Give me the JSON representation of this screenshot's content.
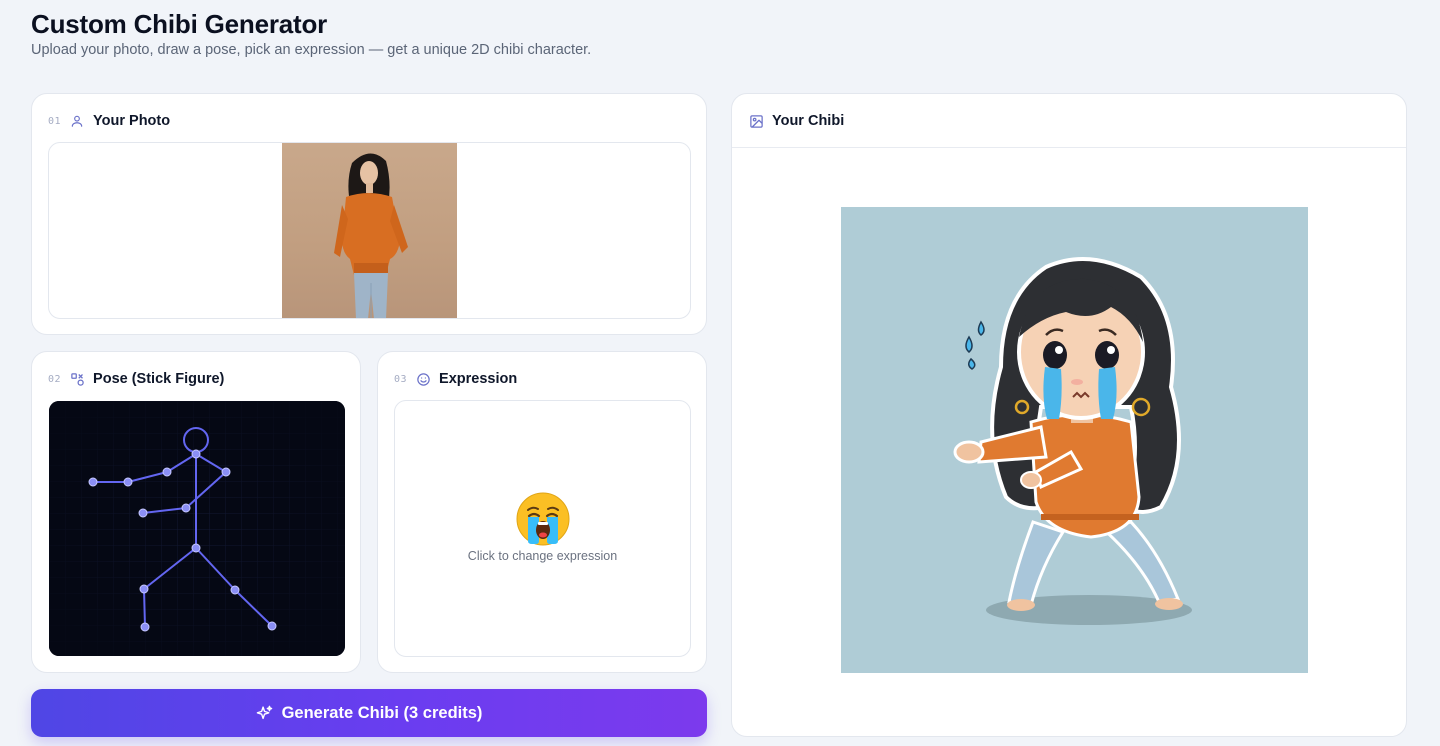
{
  "header": {
    "title": "Custom Chibi Generator",
    "subtitle": "Upload your photo, draw a pose, pick an expression — get a unique 2D chibi character."
  },
  "photo": {
    "step": "01",
    "title": "Your Photo",
    "icon": "user-icon"
  },
  "pose": {
    "step": "02",
    "title": "Pose (Stick Figure)",
    "icon": "pose-shapes-icon"
  },
  "expression": {
    "step": "03",
    "title": "Expression",
    "icon": "smile-icon",
    "emoji": "loudly-crying-face",
    "hint": "Click to change expression"
  },
  "generate": {
    "label": "Generate Chibi (3 credits)",
    "icon": "sparkles-icon"
  },
  "result": {
    "title": "Your Chibi",
    "icon": "image-icon"
  },
  "colors": {
    "accent_start": "#4f46e5",
    "accent_end": "#7c3aed",
    "pose_bg": "#050814",
    "pose_line": "#6366f1",
    "chibi_bg": "#afccd6"
  }
}
